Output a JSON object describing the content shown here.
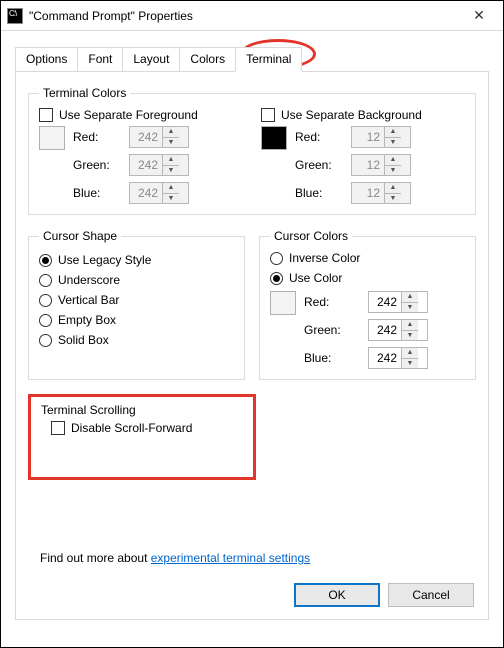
{
  "window": {
    "title": "\"Command Prompt\" Properties",
    "close": "✕"
  },
  "tabs": {
    "options": "Options",
    "font": "Font",
    "layout": "Layout",
    "colors": "Colors",
    "terminal": "Terminal"
  },
  "terminalColors": {
    "legend": "Terminal Colors",
    "sepFg": "Use Separate Foreground",
    "sepBg": "Use Separate Background",
    "red": "Red:",
    "green": "Green:",
    "blue": "Blue:",
    "fg": {
      "r": "242",
      "g": "242",
      "b": "242"
    },
    "bg": {
      "r": "12",
      "g": "12",
      "b": "12"
    }
  },
  "cursorShape": {
    "legend": "Cursor Shape",
    "legacy": "Use Legacy Style",
    "underscore": "Underscore",
    "vbar": "Vertical Bar",
    "empty": "Empty Box",
    "solid": "Solid Box"
  },
  "cursorColors": {
    "legend": "Cursor Colors",
    "inverse": "Inverse Color",
    "usecolor": "Use Color",
    "red": "Red:",
    "green": "Green:",
    "blue": "Blue:",
    "r": "242",
    "g": "242",
    "b": "242"
  },
  "scrolling": {
    "legend": "Terminal Scrolling",
    "disable": "Disable Scroll-Forward"
  },
  "link": {
    "prefix": "Find out more about ",
    "text": "experimental terminal settings"
  },
  "buttons": {
    "ok": "OK",
    "cancel": "Cancel"
  }
}
